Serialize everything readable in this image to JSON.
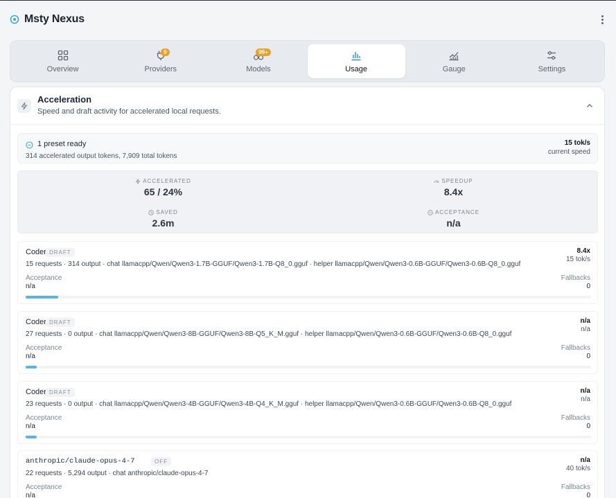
{
  "app": {
    "title": "Msty Nexus"
  },
  "tabs": [
    {
      "label": "Overview",
      "icon": "grid-icon",
      "badge": ""
    },
    {
      "label": "Providers",
      "icon": "plug-icon",
      "badge": "9"
    },
    {
      "label": "Models",
      "icon": "cubes-icon",
      "badge": "99+"
    },
    {
      "label": "Usage",
      "icon": "bar-chart-icon",
      "badge": "",
      "active": true
    },
    {
      "label": "Gauge",
      "icon": "line-chart-icon",
      "badge": ""
    },
    {
      "label": "Settings",
      "icon": "sliders-icon",
      "badge": ""
    }
  ],
  "colors": {
    "accent": "#55b6df",
    "badge": "#f0a020"
  },
  "acceleration": {
    "title": "Acceleration",
    "subtitle": "Speed and draft activity for accelerated local requests.",
    "preset": {
      "title": "1 preset ready",
      "summary": "314 accelerated output tokens, 7,909 total tokens",
      "speed_value": "15 tok/s",
      "speed_label": "current speed"
    },
    "stats": {
      "accelerated": {
        "label": "ACCELERATED",
        "value": "65 / 24%"
      },
      "speedup": {
        "label": "SPEEDUP",
        "value": "8.4x"
      },
      "saved": {
        "label": "SAVED",
        "value": "2.6m"
      },
      "acceptance": {
        "label": "ACCEPTANCE",
        "value": "n/a"
      }
    },
    "rows": [
      {
        "name": "Coder",
        "tag": "DRAFT",
        "details": "15 requests · 314 output · chat llamacpp/Qwen/Qwen3-1.7B-GGUF/Qwen3-1.7B-Q8_0.gguf · helper llamacpp/Qwen/Qwen3-0.6B-GGUF/Qwen3-0.6B-Q8_0.gguf",
        "right_value": "8.4x",
        "right_sub": "15 tok/s",
        "acceptance_label": "Acceptance",
        "acceptance_value": "n/a",
        "fallbacks_label": "Fallbacks",
        "fallbacks_value": "0",
        "progress": 0.058
      },
      {
        "name": "Coder",
        "tag": "DRAFT",
        "details": "27 requests · 0 output · chat llamacpp/Qwen/Qwen3-8B-GGUF/Qwen3-8B-Q5_K_M.gguf · helper llamacpp/Qwen/Qwen3-0.6B-GGUF/Qwen3-0.6B-Q8_0.gguf",
        "right_value": "n/a",
        "right_sub": "n/a",
        "acceptance_label": "Acceptance",
        "acceptance_value": "n/a",
        "fallbacks_label": "Fallbacks",
        "fallbacks_value": "0",
        "progress": 0.02
      },
      {
        "name": "Coder",
        "tag": "DRAFT",
        "details": "23 requests · 0 output · chat llamacpp/Qwen/Qwen3-4B-GGUF/Qwen3-4B-Q4_K_M.gguf · helper llamacpp/Qwen/Qwen3-0.6B-GGUF/Qwen3-0.6B-Q8_0.gguf",
        "right_value": "n/a",
        "right_sub": "n/a",
        "acceptance_label": "Acceptance",
        "acceptance_value": "n/a",
        "fallbacks_label": "Fallbacks",
        "fallbacks_value": "0",
        "progress": 0.02
      },
      {
        "name": "anthropic/claude-opus-4-7",
        "tag": "OFF",
        "details": "22 requests · 5,294 output · chat anthropic/claude-opus-4-7",
        "right_value": "n/a",
        "right_sub": "40 tok/s",
        "acceptance_label": "Acceptance",
        "acceptance_value": "n/a",
        "fallbacks_label": "Fallbacks",
        "fallbacks_value": "0",
        "progress": 0
      }
    ]
  }
}
